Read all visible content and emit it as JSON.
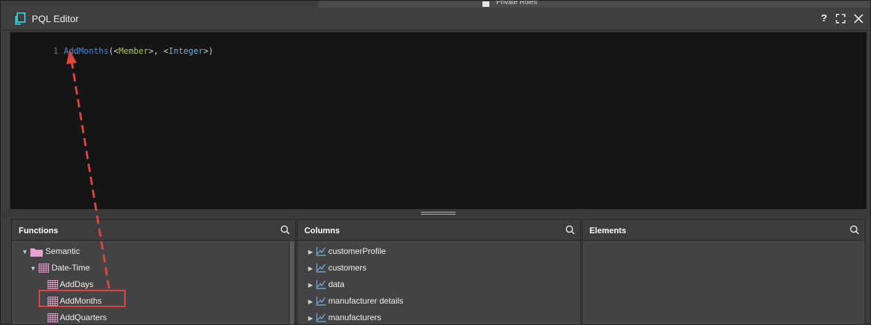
{
  "window": {
    "title": "PQL Editor"
  },
  "background": {
    "text": "Private Roles"
  },
  "editor": {
    "line_number": "1",
    "code": {
      "fn": "AddMonths",
      "open": "(<",
      "param1": "Member",
      "mid": ">, <",
      "param2": "Integer",
      "close": ">)"
    }
  },
  "functions": {
    "title": "Functions",
    "items": [
      {
        "label": "Semantic",
        "icon": "folder-icon"
      },
      {
        "label": "Date-Time",
        "icon": "table-icon"
      },
      {
        "label": "AddDays",
        "icon": "table-icon"
      },
      {
        "label": "AddMonths",
        "icon": "table-icon"
      },
      {
        "label": "AddQuarters",
        "icon": "table-icon"
      }
    ]
  },
  "columns": {
    "title": "Columns",
    "items": [
      {
        "label": "customerProfile"
      },
      {
        "label": "customers"
      },
      {
        "label": "data"
      },
      {
        "label": "manufacturer details"
      },
      {
        "label": "manufacturers"
      }
    ]
  },
  "elements": {
    "title": "Elements"
  },
  "colors": {
    "highlight": "#e0463d",
    "function_text": "#4a88d8",
    "param_member": "#a7c43a",
    "param_integer": "#6ab0e0"
  }
}
